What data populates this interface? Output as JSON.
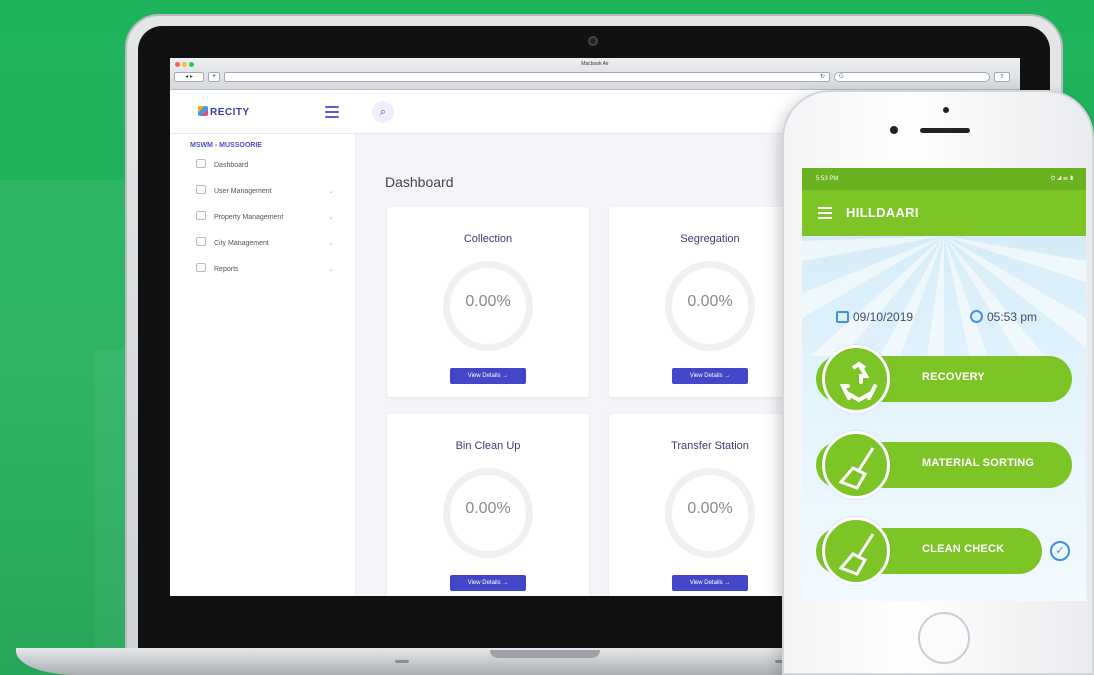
{
  "browser": {
    "window_title": "Macbook Air",
    "nav_label": "◂ ▸",
    "add_tab": "+",
    "reload": "↻",
    "search_glyph": "G",
    "share": "⇧"
  },
  "app": {
    "logo": "RECITY",
    "org_label": "MSWM - MUSSOORIE",
    "search_glyph": "⌕"
  },
  "sidebar": {
    "items": [
      {
        "label": "Dashboard",
        "has_children": false
      },
      {
        "label": "User Management",
        "has_children": true
      },
      {
        "label": "Property Management",
        "has_children": true
      },
      {
        "label": "City Management",
        "has_children": true
      },
      {
        "label": "Reports",
        "has_children": true
      }
    ],
    "chevron": "⌄"
  },
  "content": {
    "title": "Dashboard",
    "cards": [
      {
        "title": "Collection",
        "value": "0.00%",
        "button": "View Details →"
      },
      {
        "title": "Segregation",
        "value": "0.00%",
        "button": "View Details →"
      },
      {
        "title": "Bin Clean Up",
        "value": "0.00%",
        "button": "View Details →"
      },
      {
        "title": "Transfer Station",
        "value": "0.00%",
        "button": "View Details →"
      }
    ]
  },
  "phone": {
    "status_time": "5:53 PM",
    "status_icons": "⏱ ◢ ☰ ▮",
    "app_title": "HILLDAARI",
    "date": "09/10/2019",
    "time": "05:53 pm",
    "actions": [
      {
        "label": "RECOVERY",
        "icon": "recycle-icon"
      },
      {
        "label": "MATERIAL SORTING",
        "icon": "broom-icon"
      },
      {
        "label": "CLEAN CHECK",
        "icon": "broom-icon",
        "checked": true
      }
    ],
    "check_glyph": "✓"
  },
  "colors": {
    "background": "#22b05a",
    "app_green": "#7dc526",
    "accent_blue": "#4446c9"
  }
}
